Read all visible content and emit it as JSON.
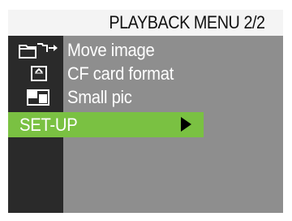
{
  "menu": {
    "title": "PLAYBACK MENU 2/2",
    "items": [
      {
        "label": "Move image",
        "icon": "move-image-icon"
      },
      {
        "label": "CF card format",
        "icon": "cf-card-format-icon"
      },
      {
        "label": "Small pic",
        "icon": "small-pic-icon"
      }
    ],
    "selected": {
      "label": "SET-UP",
      "icon": "right-arrow-icon"
    }
  },
  "colors": {
    "highlight": "#7ac142",
    "background": "#8e8e8e",
    "icon_column": "#2a2a2a",
    "title_bar": "#f4f4f4"
  }
}
